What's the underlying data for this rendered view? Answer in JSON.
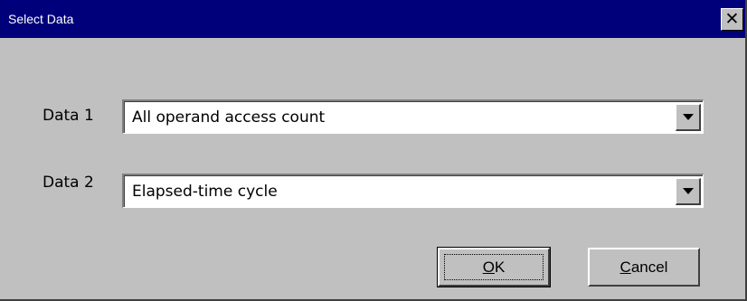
{
  "window": {
    "title": "Select Data",
    "close_glyph": "✕"
  },
  "fields": [
    {
      "label": "Data 1",
      "value": "All operand access count"
    },
    {
      "label": "Data 2",
      "value": "Elapsed-time cycle"
    }
  ],
  "buttons": {
    "ok": {
      "access_key": "O",
      "rest": "K"
    },
    "cancel": {
      "access_key": "C",
      "rest": "ancel"
    }
  },
  "colors": {
    "titlebar": "#00007b",
    "face": "#c0c0c0"
  },
  "icons": {
    "close": "close-icon",
    "dropdown": "chevron-down-icon"
  }
}
